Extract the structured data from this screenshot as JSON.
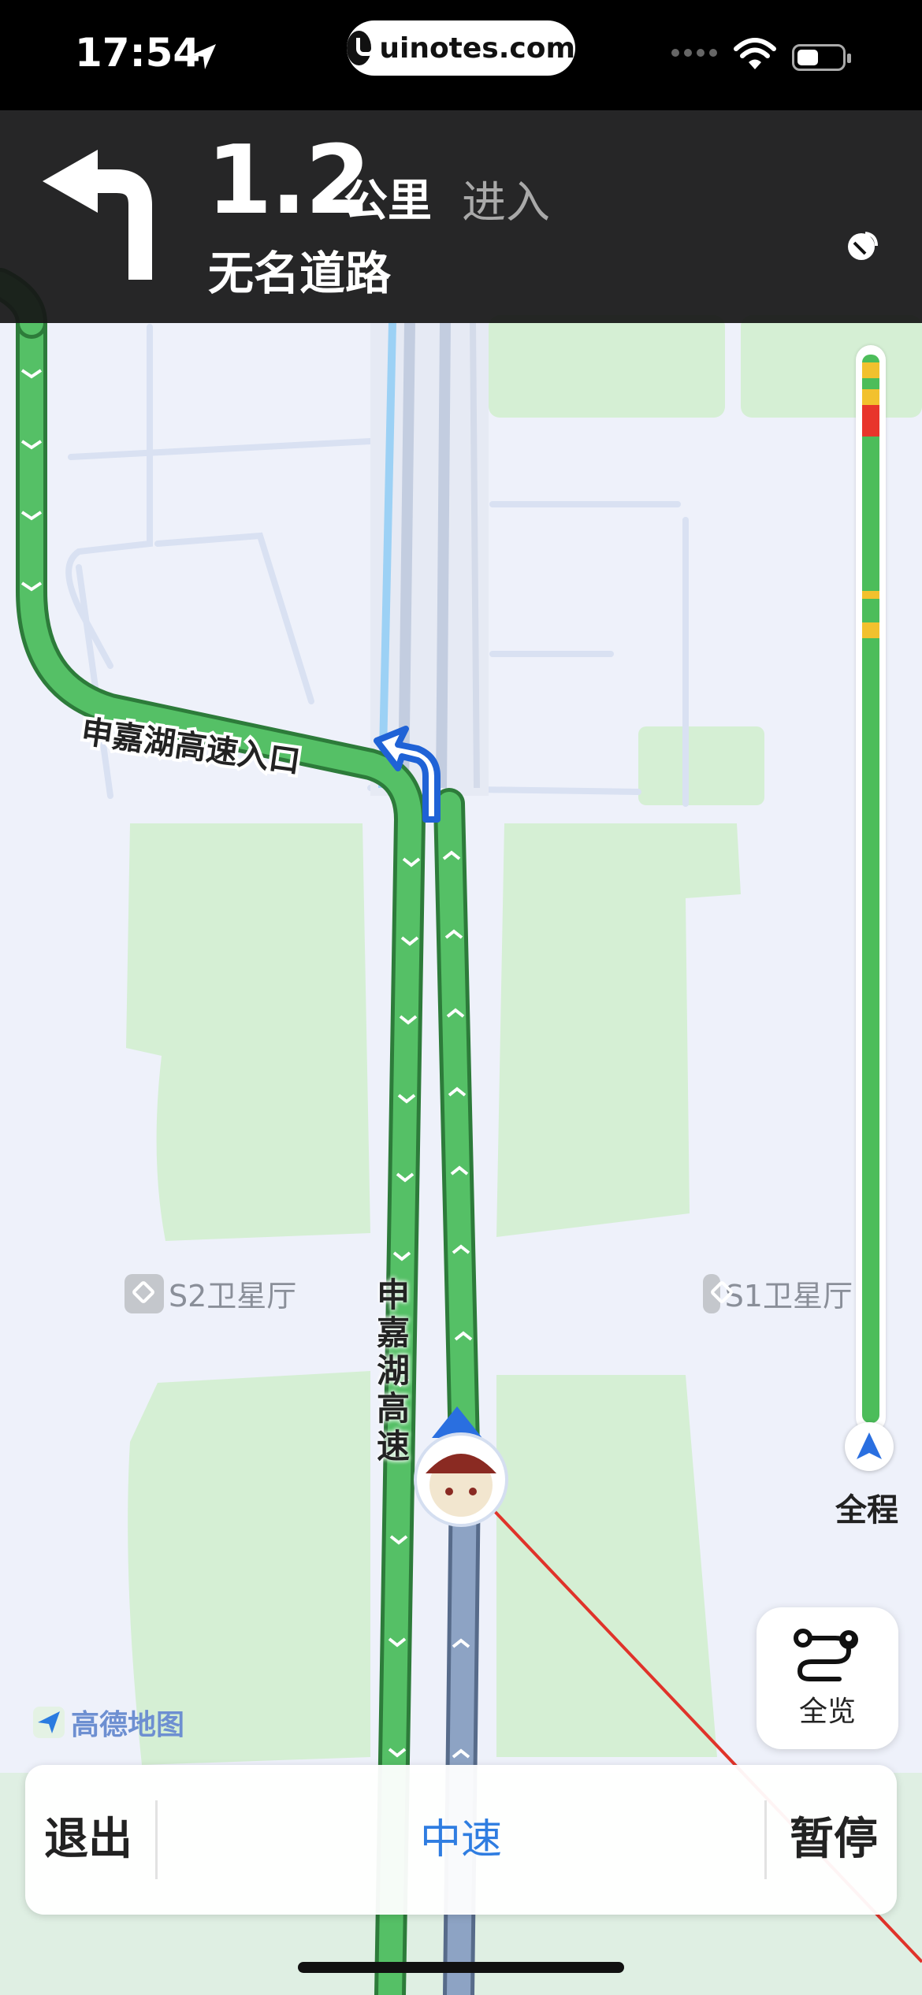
{
  "status_bar": {
    "time": "17:54",
    "url": "uinotes.com"
  },
  "navigation": {
    "distance_value": "1.2",
    "distance_unit": "公里",
    "action": "进入",
    "next_road": "无名道路",
    "turn": "left-turn-icon"
  },
  "map": {
    "route_label_entrance": "申嘉湖高速入口",
    "route_label_highway": "申嘉湖高速",
    "poi_left": "S2卫星厅",
    "poi_right": "S1卫星厅",
    "brand": "高德地图"
  },
  "route_progress": {
    "label": "全程",
    "colors": {
      "clear": "#4cbd5a",
      "slow": "#f2c12e",
      "jam": "#e8352b"
    }
  },
  "overview_button": {
    "label": "全览"
  },
  "bottom_bar": {
    "exit_label": "退出",
    "speed_label": "中速",
    "pause_label": "暂停"
  }
}
